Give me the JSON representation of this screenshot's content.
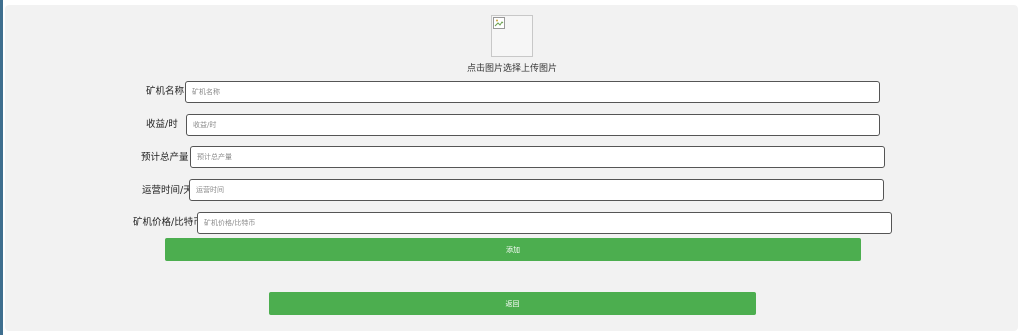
{
  "form": {
    "upload_caption": "点击图片选择上传图片",
    "fields": [
      {
        "label": "矿机名称",
        "placeholder": "矿机名称"
      },
      {
        "label": "收益/时",
        "placeholder": "收益/时"
      },
      {
        "label": "预计总产量",
        "placeholder": "预计总产量"
      },
      {
        "label": "运营时间/天",
        "placeholder": "运营时间"
      },
      {
        "label": "矿机价格/比特币",
        "placeholder": "矿机价格/比特币"
      }
    ],
    "add_button": "添加",
    "back_button": "返回"
  },
  "icons": {
    "image_placeholder": "broken-image-icon"
  },
  "colors": {
    "button_green": "#4cae4f",
    "panel_background": "#f2f2f2"
  }
}
